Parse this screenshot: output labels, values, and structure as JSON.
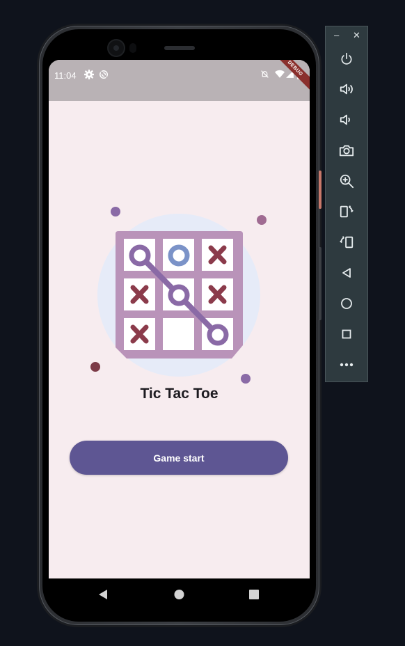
{
  "status_bar": {
    "time": "11:04",
    "debug_banner": "DEBUG"
  },
  "app": {
    "title": "Tic Tac Toe",
    "start_button": "Game start"
  },
  "board": {
    "cells": [
      "O",
      "O",
      "X",
      "X",
      "O",
      "X",
      "X",
      "",
      "O"
    ],
    "winning_line": "top-left to bottom-right diagonal"
  },
  "colors": {
    "background": "#f7ecef",
    "status_bar": "#b9b2b5",
    "button": "#5e5693",
    "board_frame": "#b993b9",
    "x_mark": "#8b3b4b",
    "o_mark": "#8a6aa6",
    "o_highlight": "#7b93c8",
    "circle_bg": "#e6ebf8"
  },
  "toolbar": {
    "window_controls": [
      "minimize",
      "close"
    ],
    "minimize_label": "–",
    "close_label": "✕",
    "buttons": [
      "power",
      "volume-up",
      "volume-down",
      "camera",
      "zoom",
      "rotate-left",
      "rotate-right",
      "back",
      "home",
      "overview",
      "more"
    ]
  },
  "nav_bar": {
    "buttons": [
      "back",
      "home",
      "recents"
    ]
  }
}
